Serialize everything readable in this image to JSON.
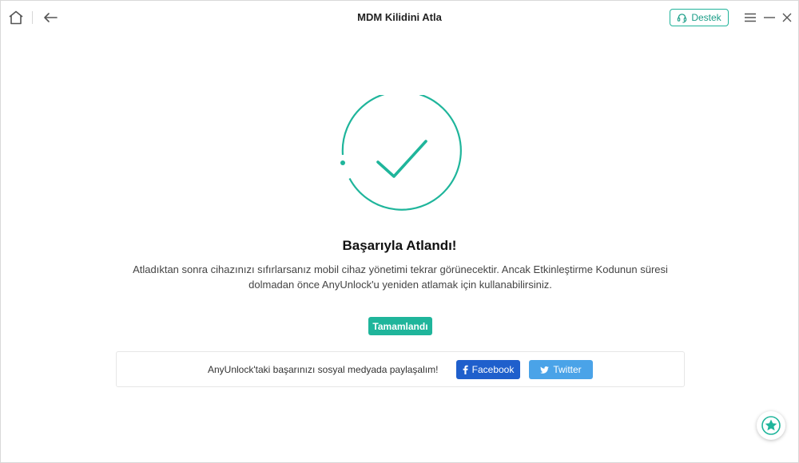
{
  "window": {
    "title": "MDM Kilidini Atla",
    "support_label": "Destek"
  },
  "icons": {
    "home": "home-icon",
    "back": "back-arrow-icon",
    "support": "headset-icon",
    "menu": "hamburger-menu-icon",
    "minimize": "minimize-icon",
    "close": "close-icon",
    "success": "checkmark-circle-icon",
    "facebook": "facebook-icon",
    "twitter": "twitter-icon",
    "badge": "star-badge-icon"
  },
  "colors": {
    "accent": "#1fb59b",
    "facebook": "#1f5fcc",
    "twitter": "#4aa3e8"
  },
  "main": {
    "headline": "Başarıyla Atlandı!",
    "description_line1": "Atladıktan sonra cihazınızı sıfırlarsanız mobil cihaz yönetimi tekrar görünecektir. Ancak Etkinleştirme Kodunun süresi",
    "description_line2": "dolmadan önce AnyUnlock'u yeniden atlamak için kullanabilirsiniz.",
    "done_label": "Tamamlandı"
  },
  "share": {
    "text": "AnyUnlock'taki başarınızı sosyal medyada paylaşalım!",
    "facebook_label": "Facebook",
    "twitter_label": "Twitter"
  }
}
